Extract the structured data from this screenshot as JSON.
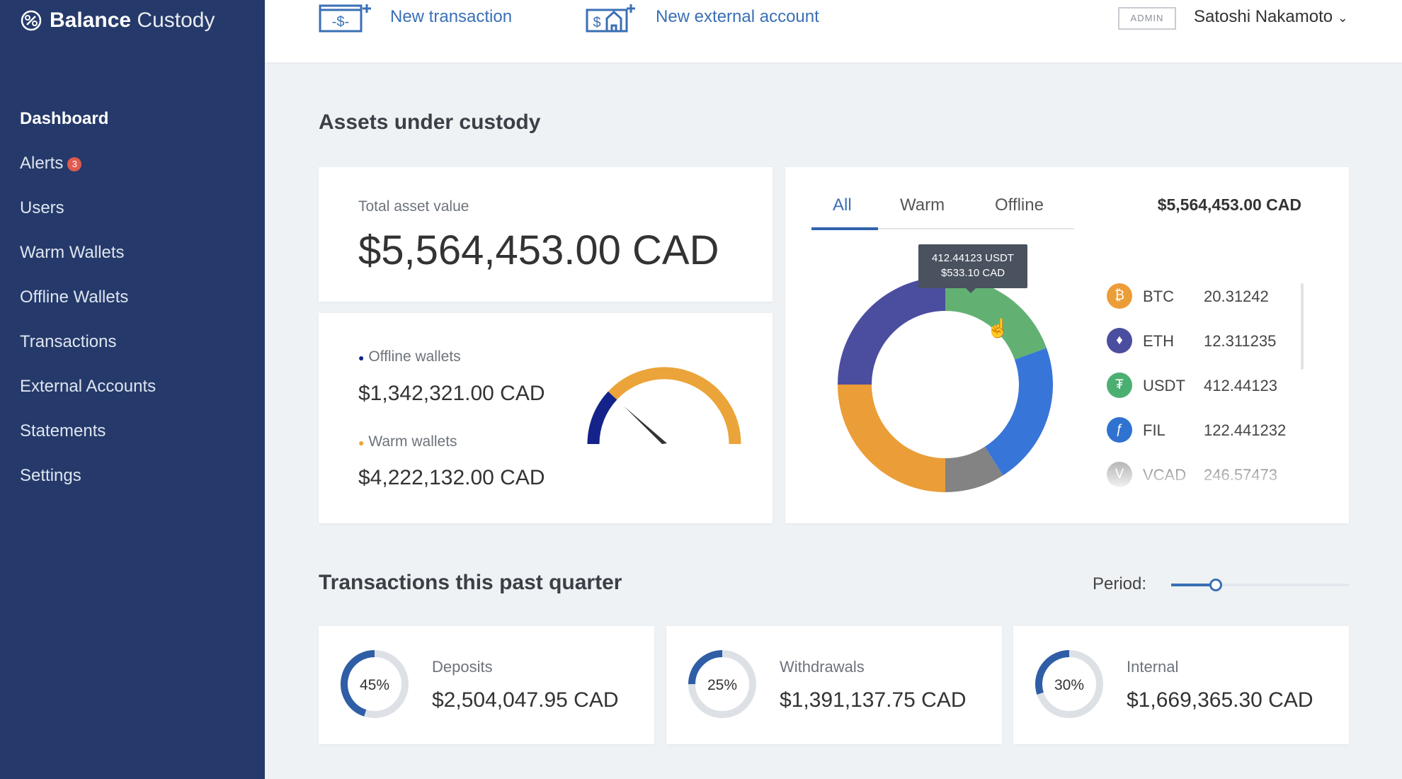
{
  "app": {
    "brand_bold": "Balance",
    "brand_light": "Custody"
  },
  "sidebar": {
    "items": [
      {
        "label": "Dashboard",
        "active": true
      },
      {
        "label": "Alerts",
        "badge": "3"
      },
      {
        "label": "Users"
      },
      {
        "label": "Warm Wallets"
      },
      {
        "label": "Offline Wallets"
      },
      {
        "label": "Transactions"
      },
      {
        "label": "External Accounts"
      },
      {
        "label": "Statements"
      },
      {
        "label": "Settings"
      }
    ]
  },
  "header": {
    "new_transaction": "New transaction",
    "new_external_account": "New external account",
    "role_badge": "ADMIN",
    "user_name": "Satoshi Nakamoto"
  },
  "assets": {
    "title": "Assets under custody",
    "total": {
      "label": "Total asset value",
      "value": "$5,564,453.00 CAD"
    },
    "split": {
      "offline_label": "Offline wallets",
      "offline_value": "$1,342,321.00 CAD",
      "warm_label": "Warm wallets",
      "warm_value": "$4,222,132.00 CAD",
      "offline_fraction": 0.24,
      "offline_color": "#13238a",
      "warm_color": "#eba43a"
    },
    "breakdown": {
      "tabs": [
        "All",
        "Warm",
        "Offline"
      ],
      "active_tab": "All",
      "total": "$5,564,453.00 CAD",
      "tooltip": {
        "line1": "412.44123 USDT",
        "line2": "$533.10 CAD"
      },
      "slices": [
        {
          "color": "#62b173",
          "percent": 19.5
        },
        {
          "color": "#3875d8",
          "percent": 21.5
        },
        {
          "color": "#838383",
          "percent": 9
        },
        {
          "color": "#eb9d38",
          "percent": 25
        },
        {
          "color": "#4b4d9f",
          "percent": 25
        }
      ],
      "assets": [
        {
          "symbol": "BTC",
          "amount": "20.31242",
          "color": "#eb9d38",
          "glyph": "₿"
        },
        {
          "symbol": "ETH",
          "amount": "12.311235",
          "color": "#4b4d9f",
          "glyph": "♦"
        },
        {
          "symbol": "USDT",
          "amount": "412.44123",
          "color": "#4caf72",
          "glyph": "₮"
        },
        {
          "symbol": "FIL",
          "amount": "122.441232",
          "color": "#2f72d0",
          "glyph": "ƒ"
        },
        {
          "symbol": "VCAD",
          "amount": "246.57473",
          "color": "#9a9a9a",
          "glyph": "V"
        }
      ]
    }
  },
  "transactions": {
    "title": "Transactions this past quarter",
    "period_label": "Period:",
    "period_value": 0.25,
    "cards": [
      {
        "label": "Deposits",
        "percent": "45%",
        "fraction": 0.45,
        "value": "$2,504,047.95 CAD"
      },
      {
        "label": "Withdrawals",
        "percent": "25%",
        "fraction": 0.25,
        "value": "$1,391,137.75 CAD"
      },
      {
        "label": "Internal",
        "percent": "30%",
        "fraction": 0.3,
        "value": "$1,669,365.30 CAD"
      }
    ]
  }
}
